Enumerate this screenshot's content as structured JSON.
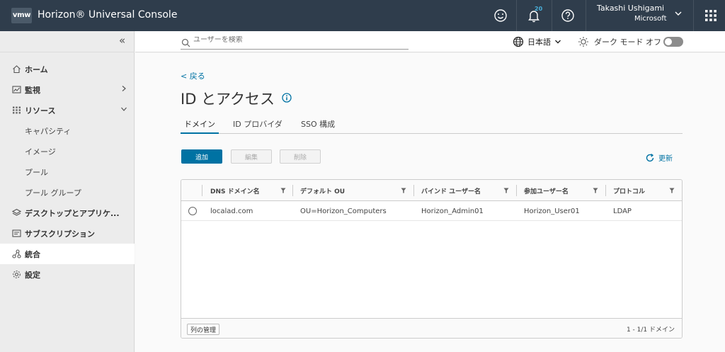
{
  "header": {
    "logo": "vmw",
    "title": "Horizon® Universal Console",
    "notification_count": "20",
    "user_name": "Takashi Ushigami",
    "user_org": "Microsoft"
  },
  "sidebar": {
    "collapse": "«",
    "items": [
      {
        "label": "ホーム",
        "icon": "home-icon"
      },
      {
        "label": "監視",
        "icon": "monitor-icon"
      },
      {
        "label": "リソース",
        "icon": "resources-icon"
      },
      {
        "label": "キャパシティ"
      },
      {
        "label": "イメージ"
      },
      {
        "label": "プール"
      },
      {
        "label": "プール グループ"
      },
      {
        "label": "デスクトップとアプリケ...",
        "icon": "layers-icon"
      },
      {
        "label": "サブスクリプション",
        "icon": "subscription-icon"
      },
      {
        "label": "統合",
        "icon": "integration-icon",
        "active": true
      },
      {
        "label": "設定",
        "icon": "gear-icon"
      }
    ]
  },
  "topbar": {
    "search_placeholder": "ユーザーを検索",
    "language": "日本語",
    "dark_mode_label": "ダーク モード オフ"
  },
  "page": {
    "back": "< 戻る",
    "title": "ID とアクセス",
    "tabs": [
      "ドメイン",
      "ID プロバイダ",
      "SSO 構成"
    ],
    "buttons": {
      "add": "追加",
      "edit": "編集",
      "delete": "削除",
      "refresh": "更新"
    }
  },
  "grid": {
    "columns": [
      "DNS ドメイン名",
      "デフォルト OU",
      "バインド ユーザー名",
      "参加ユーザー名",
      "プロトコル"
    ],
    "rows": [
      [
        "localad.com",
        "OU=Horizon_Computers",
        "Horizon_Admin01",
        "Horizon_User01",
        "LDAP"
      ]
    ],
    "column_manager": "列の管理",
    "pagination": "1 - 1/1 ドメイン"
  },
  "colors": {
    "header_bg": "#2f3d4c",
    "accent": "#0072a3",
    "sidebar_bg": "#ececec"
  }
}
